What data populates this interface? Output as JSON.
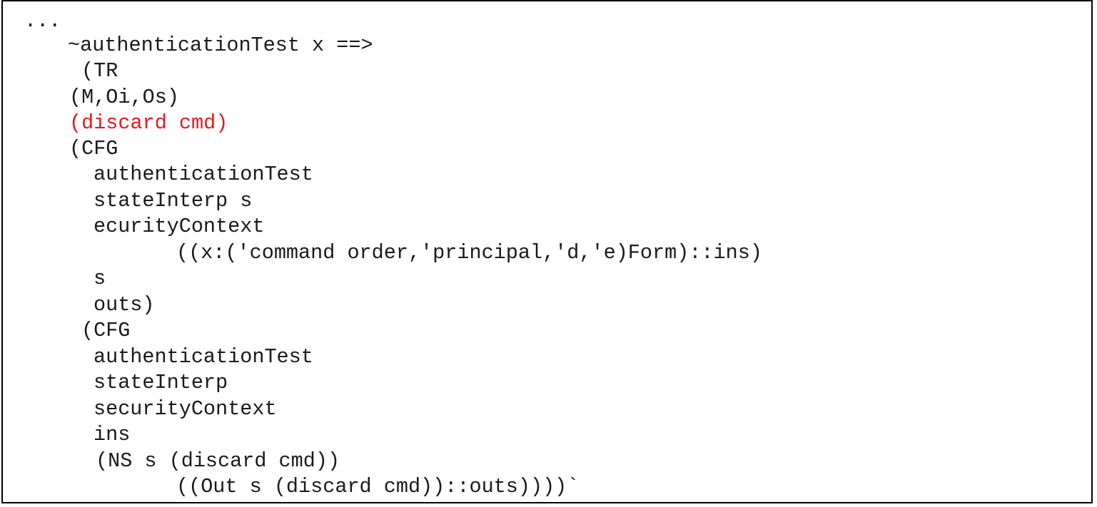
{
  "code": {
    "highlight_color": "#e8181c",
    "text_color": "#1a1a1a",
    "lines": [
      "...",
      "~authenticationTest x ==>",
      "(TR",
      "(M,Oi,Os)",
      "(discard cmd)",
      "(CFG",
      "authenticationTest",
      "stateInterp s",
      "ecurityContext",
      "((x:('command order,'principal,'d,'e)Form)::ins)",
      "s",
      "outs)",
      "(CFG",
      "authenticationTest",
      "stateInterp",
      "securityContext",
      "ins",
      "(NS s (discard cmd))",
      "((Out s (discard cmd))::outs))))`"
    ]
  }
}
